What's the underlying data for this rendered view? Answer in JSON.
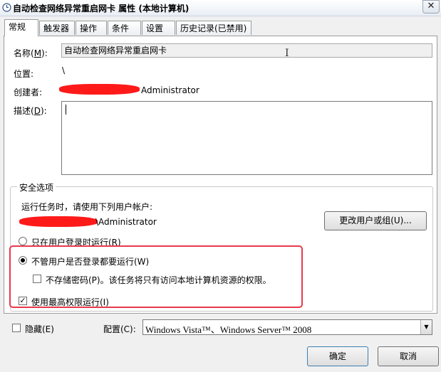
{
  "window": {
    "title": "自动检查网络异常重启网卡 属性 (本地计算机)",
    "close_glyph": "✕"
  },
  "tabs": [
    {
      "label": "常规",
      "active": true
    },
    {
      "label": "触发器"
    },
    {
      "label": "操作"
    },
    {
      "label": "条件"
    },
    {
      "label": "设置"
    },
    {
      "label": "历史记录(已禁用)"
    }
  ],
  "general": {
    "name_label": "名称(",
    "name_key": "M",
    "name_close": "):",
    "name_value": "自动检查网络异常重启网卡",
    "location_label": "位置:",
    "location_value": "\\",
    "author_label": "创建者:",
    "author_value": "Administrator",
    "desc_label": "描述(",
    "desc_key": "D",
    "desc_close": "):",
    "desc_value": ""
  },
  "security": {
    "group_title": "安全选项",
    "run_as_prompt": "运行任务时，请使用下列用户帐户:",
    "user_value": "\\Administrator",
    "change_user_button": "更改用户或组(U)...",
    "radio_logged_on": "只在用户登录时运行(R)",
    "radio_whether": "不管用户是否登录都要运行(W)",
    "radio_selected": "whether",
    "no_store_password": "不存储密码(P)。该任务将只有访问本地计算机资源的权限。",
    "no_store_password_checked": false,
    "highest_privileges": "使用最高权限运行(I)",
    "highest_privileges_checked": true
  },
  "bottom": {
    "hidden_label": "隐藏(E)",
    "hidden_checked": false,
    "configure_label": "配置(C):",
    "configure_value": "Windows Vista™、Windows Server™ 2008",
    "ok_button": "确定",
    "cancel_button": "取消"
  },
  "colors": {
    "highlight_border": "#e8394d",
    "redaction": "#ff1a1a"
  },
  "icons": [
    "task-clock-icon",
    "close-icon",
    "text-cursor-icon",
    "dropdown-arrow-icon"
  ]
}
